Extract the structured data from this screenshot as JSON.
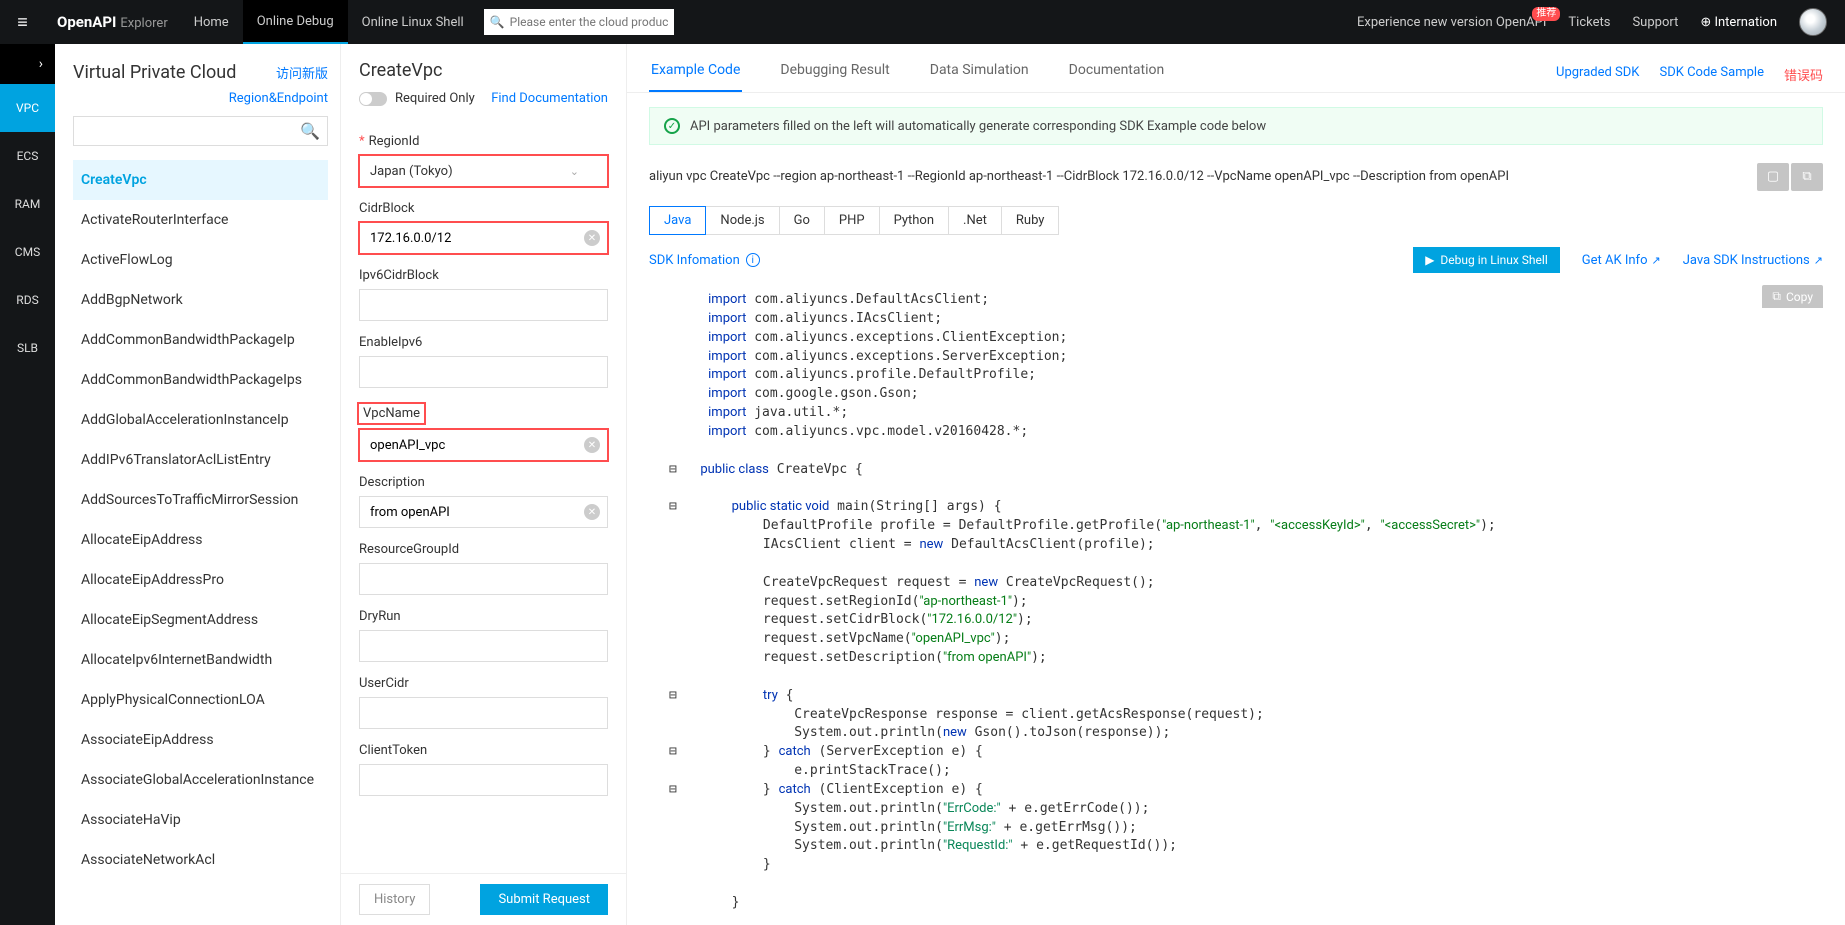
{
  "topbar": {
    "logo_bold": "OpenAPI",
    "logo_light": "Explorer",
    "nav": [
      {
        "label": "Home",
        "active": false
      },
      {
        "label": "Online Debug",
        "active": true
      },
      {
        "label": "Online Linux Shell",
        "active": false
      }
    ],
    "search_placeholder": "Please enter the cloud product",
    "experience": "Experience new version OpenAPI",
    "badge": "推荐",
    "tickets": "Tickets",
    "support": "Support",
    "internation": "Internation"
  },
  "rail": {
    "items": [
      {
        "code": "VPC",
        "active": true
      },
      {
        "code": "ECS",
        "active": false
      },
      {
        "code": "RAM",
        "active": false
      },
      {
        "code": "CMS",
        "active": false
      },
      {
        "code": "RDS",
        "active": false
      },
      {
        "code": "SLB",
        "active": false
      }
    ]
  },
  "apiList": {
    "service": "Virtual Private Cloud",
    "visit": "访问新版",
    "endpoint": "Region&Endpoint",
    "items": [
      {
        "label": "CreateVpc",
        "active": true
      },
      {
        "label": "ActivateRouterInterface"
      },
      {
        "label": "ActiveFlowLog"
      },
      {
        "label": "AddBgpNetwork"
      },
      {
        "label": "AddCommonBandwidthPackageIp"
      },
      {
        "label": "AddCommonBandwidthPackageIps"
      },
      {
        "label": "AddGlobalAccelerationInstanceIp"
      },
      {
        "label": "AddIPv6TranslatorAclListEntry"
      },
      {
        "label": "AddSourcesToTrafficMirrorSession"
      },
      {
        "label": "AllocateEipAddress"
      },
      {
        "label": "AllocateEipAddressPro"
      },
      {
        "label": "AllocateEipSegmentAddress"
      },
      {
        "label": "AllocateIpv6InternetBandwidth"
      },
      {
        "label": "ApplyPhysicalConnectionLOA"
      },
      {
        "label": "AssociateEipAddress"
      },
      {
        "label": "AssociateGlobalAccelerationInstance"
      },
      {
        "label": "AssociateHaVip"
      },
      {
        "label": "AssociateNetworkAcl"
      }
    ]
  },
  "form": {
    "operation": "CreateVpc",
    "required_only": "Required Only",
    "find_doc": "Find Documentation",
    "region_label": "RegionId",
    "region_value": "Japan (Tokyo)",
    "cidr_label": "CidrBlock",
    "cidr_value": "172.16.0.0/12",
    "ipv6cidr_label": "Ipv6CidrBlock",
    "enableipv6_label": "EnableIpv6",
    "vpcname_label": "VpcName",
    "vpcname_value": "openAPI_vpc",
    "description_label": "Description",
    "description_value": "from openAPI",
    "rg_label": "ResourceGroupId",
    "dryrun_label": "DryRun",
    "usercidr_label": "UserCidr",
    "clienttoken_label": "ClientToken",
    "history": "History",
    "submit": "Submit Request"
  },
  "content": {
    "tabs": [
      {
        "label": "Example Code",
        "active": true
      },
      {
        "label": "Debugging Result"
      },
      {
        "label": "Data Simulation"
      },
      {
        "label": "Documentation"
      }
    ],
    "right_links": {
      "upgraded": "Upgraded SDK",
      "sample": "SDK Code Sample",
      "error": "错误码"
    },
    "banner": "API parameters filled on the left will automatically generate corresponding SDK Example code below",
    "cli": "aliyun vpc CreateVpc --region ap-northeast-1 --RegionId ap-northeast-1 --CidrBlock 172.16.0.0/12 --VpcName openAPI_vpc --Description from openAPI",
    "lang_tabs": [
      {
        "label": "Java",
        "active": true
      },
      {
        "label": "Node.js"
      },
      {
        "label": "Go"
      },
      {
        "label": "PHP"
      },
      {
        "label": "Python"
      },
      {
        "label": ".Net"
      },
      {
        "label": "Ruby"
      }
    ],
    "sdk_info": "SDK Infomation",
    "debug_btn": "Debug in Linux Shell",
    "get_ak": "Get AK Info",
    "java_sdk": "Java SDK Instructions",
    "copy": "Copy"
  }
}
